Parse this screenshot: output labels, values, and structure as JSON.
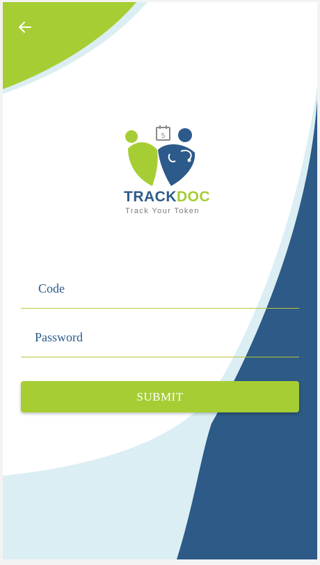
{
  "app": {
    "brand_part1": "TRACK",
    "brand_part2": "DOC",
    "tagline": "Track Your Token",
    "calendar_day": "5"
  },
  "form": {
    "code_placeholder": "Code",
    "code_value": "",
    "password_placeholder": "Password",
    "password_value": "",
    "submit_label": "SUBMIT"
  },
  "icons": {
    "back": "arrow-left-icon",
    "logo": "trackdoc-logo"
  },
  "colors": {
    "accent_green": "#a6ce34",
    "brand_blue": "#2c5a8a",
    "background_wave_blue": "#2d5a86",
    "light_wave": "#dbeef3"
  }
}
